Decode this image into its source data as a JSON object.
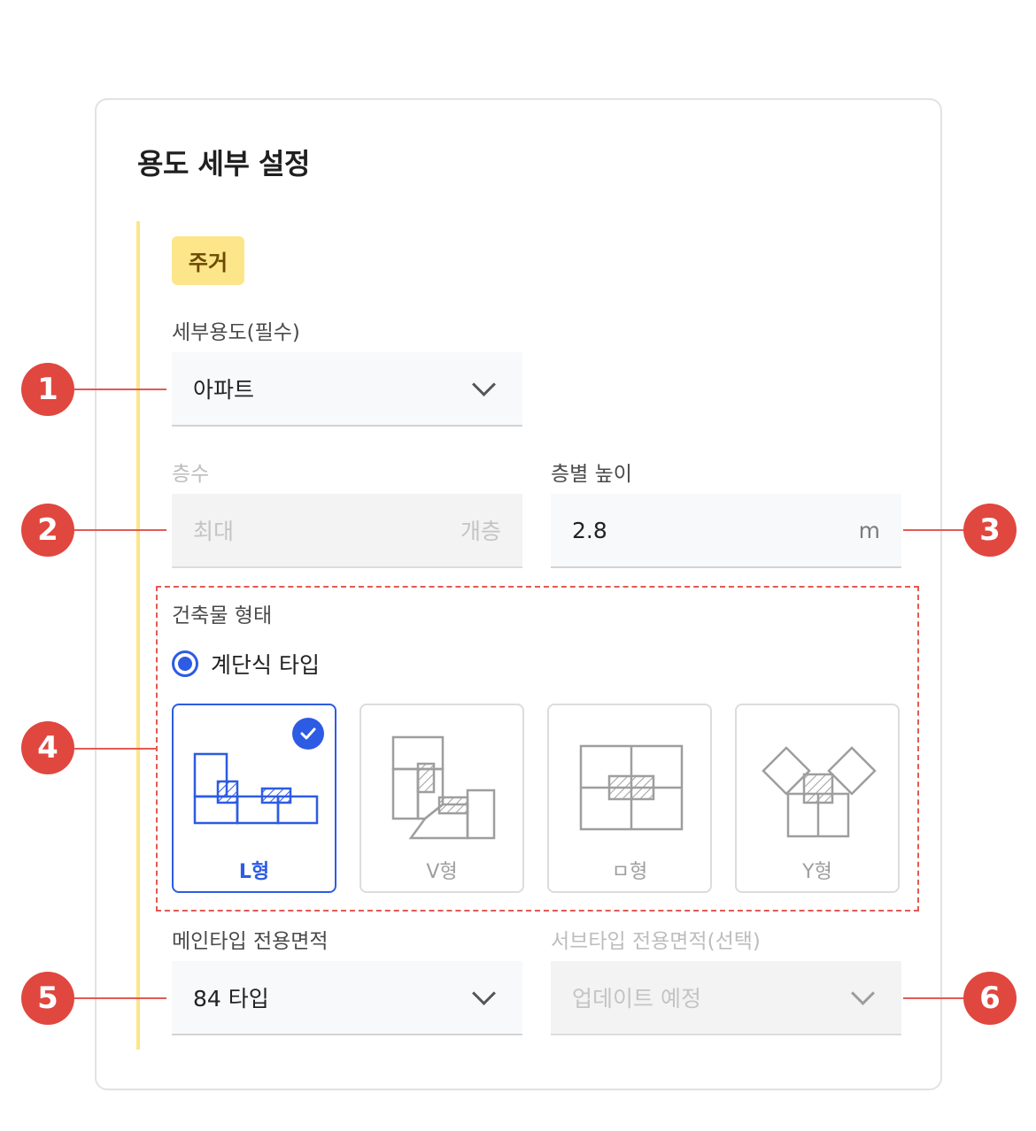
{
  "panel": {
    "title": "용도 세부 설정"
  },
  "chip": {
    "label": "주거"
  },
  "detail_use": {
    "label": "세부용도(필수)",
    "value": "아파트"
  },
  "floors": {
    "label": "층수",
    "placeholder": "최대",
    "unit": "개층",
    "disabled": true
  },
  "floor_height": {
    "label": "층별 높이",
    "value": "2.8",
    "unit": "m"
  },
  "building_form": {
    "label": "건축물 형태",
    "radio_label": "계단식 타입",
    "radio_selected": true,
    "options": [
      {
        "label": "L형",
        "selected": true
      },
      {
        "label": "V형",
        "selected": false
      },
      {
        "label": "ㅁ형",
        "selected": false
      },
      {
        "label": "Y형",
        "selected": false
      }
    ]
  },
  "main_area": {
    "label": "메인타입 전용면적",
    "value": "84 타입"
  },
  "sub_area": {
    "label": "서브타입 전용면적(선택)",
    "value": "업데이트 예정",
    "disabled": true
  },
  "callouts": [
    "1",
    "2",
    "3",
    "4",
    "5",
    "6"
  ],
  "colors": {
    "accent": "#2d5be3",
    "chip_bg": "#fde58a",
    "callout": "#e0473f",
    "section_line": "#fde58a"
  }
}
